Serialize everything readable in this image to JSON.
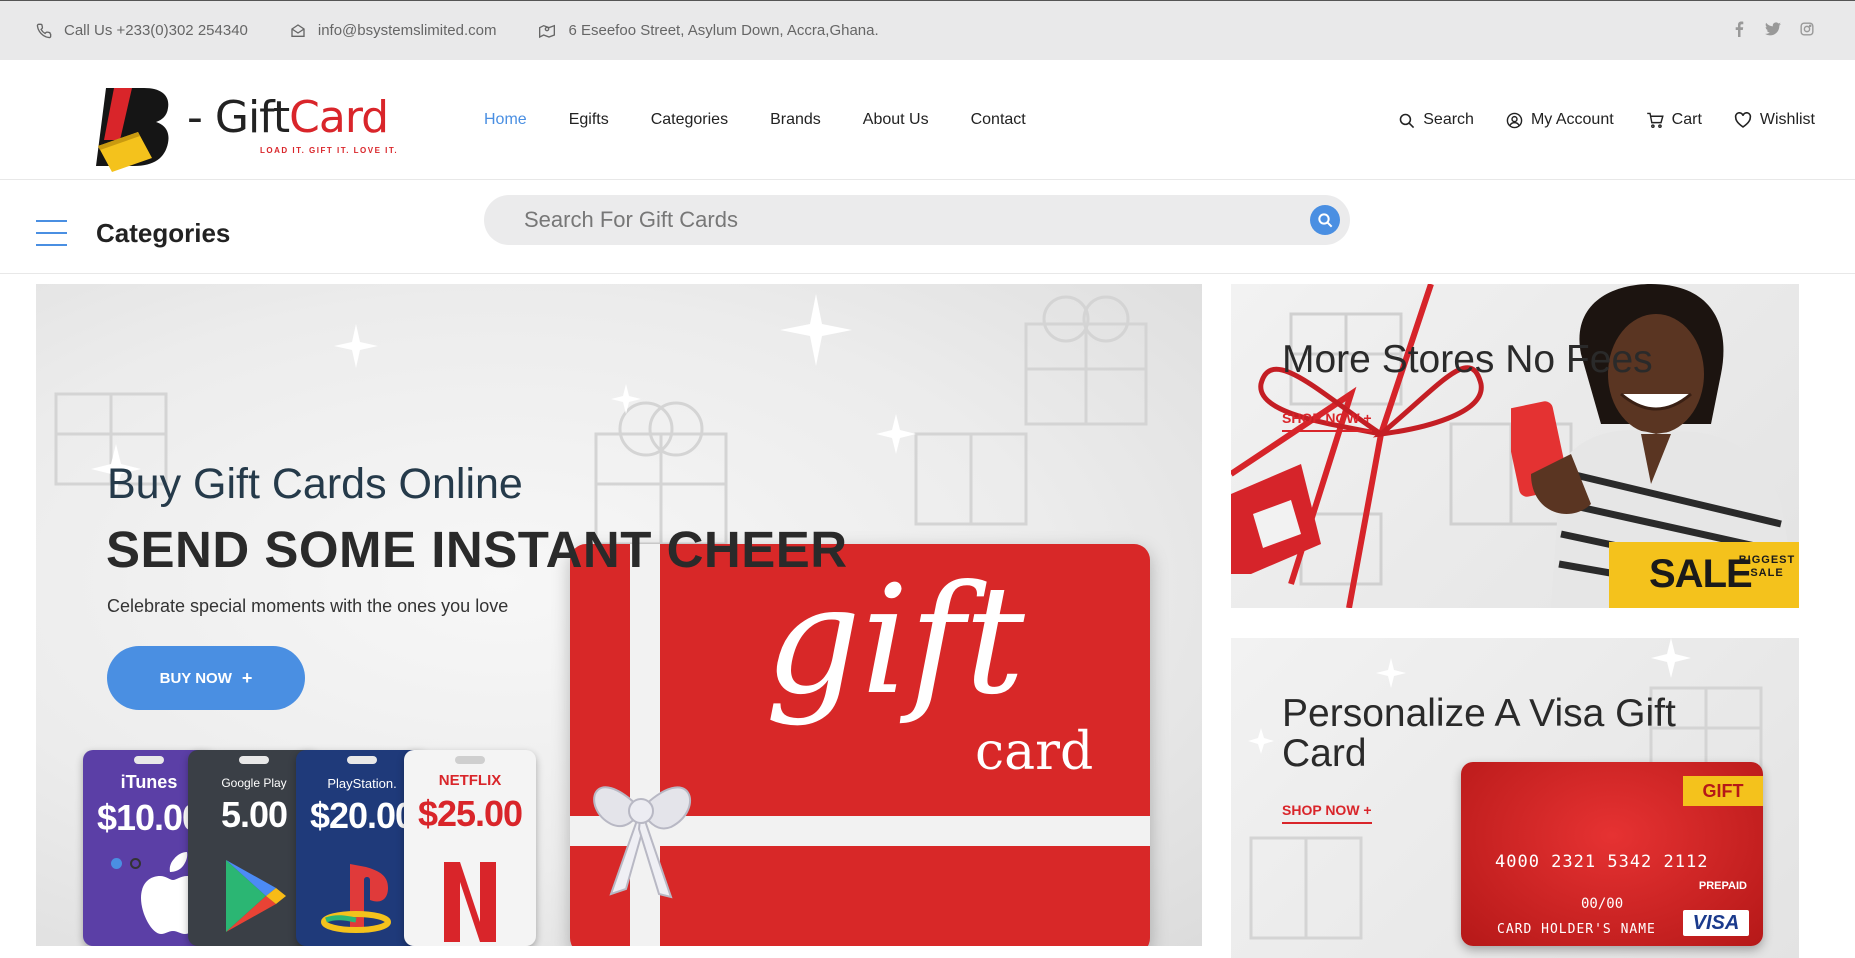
{
  "topbar": {
    "phone": "Call Us +233(0)302 254340",
    "email": "info@bsystemslimited.com",
    "address": "6 Eseefoo Street, Asylum Down, Accra,Ghana.",
    "social": [
      "facebook-icon",
      "twitter-icon",
      "instagram-icon"
    ]
  },
  "logo": {
    "text_prefix": "- Gift",
    "text_suffix": "Card",
    "tagline": "LOAD IT. GIFT IT. LOVE IT."
  },
  "nav": {
    "items": [
      "Home",
      "Egifts",
      "Categories",
      "Brands",
      "About Us",
      "Contact"
    ],
    "active": "Home"
  },
  "user_nav": {
    "search": "Search",
    "account": "My Account",
    "cart": "Cart",
    "wishlist": "Wishlist"
  },
  "catbar": {
    "title": "Categories",
    "search_placeholder": "Search For Gift Cards"
  },
  "hero": {
    "subtitle": "Buy Gift Cards Online",
    "headline": "SEND SOME INSTANT CHEER",
    "description": "Celebrate special moments with the ones you love",
    "button": "BUY NOW",
    "card_word1": "gift",
    "card_word2": "card",
    "mini_cards": [
      {
        "brand": "iTunes",
        "amount": "$10.00",
        "color": "#5b3fa6"
      },
      {
        "brand": "Google Play",
        "amount": "5.00",
        "color": "#3a3f46"
      },
      {
        "brand": "PlayStation.",
        "amount": "$20.00",
        "color": "#1f3a7a"
      },
      {
        "brand": "NETFLIX",
        "amount": "$25.00",
        "color": "#f4f4f4"
      }
    ]
  },
  "banner1": {
    "title": "More Stores No Fees",
    "cta": "SHOP NOW",
    "sale": "SALE",
    "sale_sub": "BIGGEST SALE"
  },
  "banner2": {
    "title": "Personalize A Visa Gift Card",
    "cta": "SHOP NOW",
    "card_tag": "GIFT",
    "card_number": "4000 2321 5342 2112",
    "card_prepaid": "PREPAID",
    "card_expiry": "00/00",
    "card_holder": "CARD HOLDER'S NAME",
    "card_brand": "VISA"
  },
  "colors": {
    "accent": "#4a8fe2",
    "brand_red": "#d9252a",
    "sale_yellow": "#f4c21c"
  }
}
